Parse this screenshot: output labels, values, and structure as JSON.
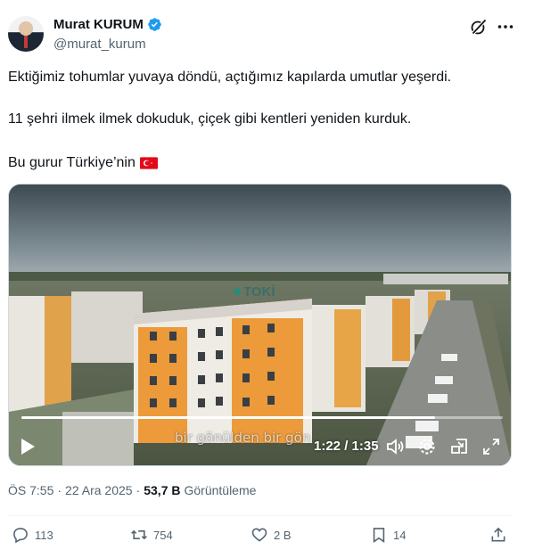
{
  "author": {
    "display_name": "Murat KURUM",
    "handle": "@murat_kurum",
    "verified": true
  },
  "tweet": {
    "lines": [
      "Ektiğimiz tohumlar yuvaya döndü, açtığımız kapılarda umutlar yeşerdi.",
      "11 şehri ilmek ilmek dokuduk, çiçek gibi kentleri yeniden kurduk.",
      "Bu gurur Türkiye’nin"
    ],
    "flag_emoji": "turkey-flag"
  },
  "video": {
    "building_sign": "TOKİ",
    "caption": "bir gönülden bir gön",
    "time_display": "1:22 / 1:35",
    "progress": 0.86
  },
  "meta": {
    "time": "ÖS 7:55",
    "separator": "·",
    "date": "22 Ara 2025",
    "views_count": "53,7 B",
    "views_label": "Görüntüleme"
  },
  "actions": {
    "replies": "113",
    "reposts": "754",
    "likes": "2 B",
    "bookmarks": "14"
  },
  "colors": {
    "text": "#0f1419",
    "secondary": "#536471",
    "verified": "#1d9bf0",
    "flag_red": "#e30a17"
  }
}
